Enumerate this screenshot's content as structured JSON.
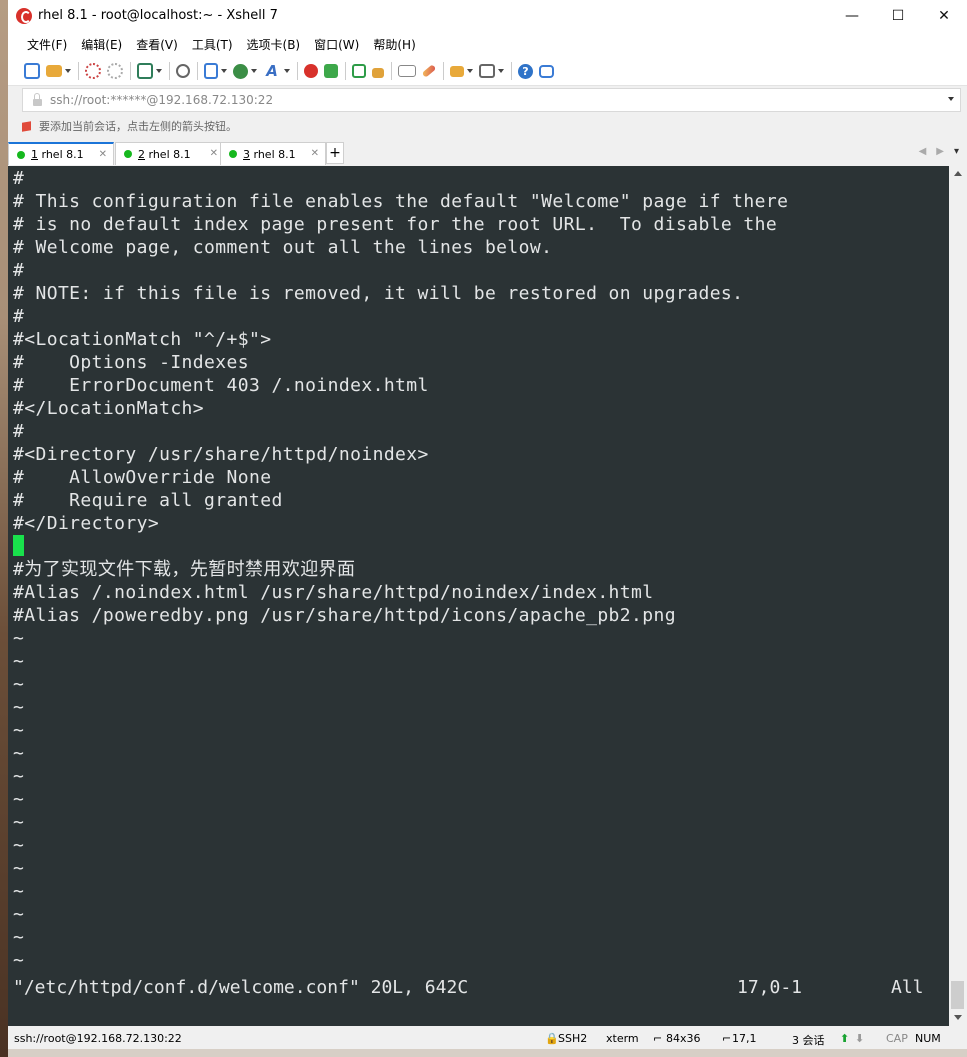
{
  "window": {
    "title": "rhel 8.1 - root@localhost:~ - Xshell 7",
    "minimize": "—",
    "maximize": "☐",
    "close": "✕"
  },
  "menu": [
    "文件(F)",
    "编辑(E)",
    "查看(V)",
    "工具(T)",
    "选项卡(B)",
    "窗口(W)",
    "帮助(H)"
  ],
  "address": {
    "value": "ssh://root:******@192.168.72.130:22"
  },
  "hint": "要添加当前会话，点击左侧的箭头按钮。",
  "tabs": [
    {
      "num": "1",
      "label": " rhel 8.1"
    },
    {
      "num": "2",
      "label": " rhel 8.1"
    },
    {
      "num": "3",
      "label": " rhel 8.1"
    }
  ],
  "tab_plus": "+",
  "terminal": {
    "lines": [
      "#",
      "# This configuration file enables the default \"Welcome\" page if there",
      "# is no default index page present for the root URL.  To disable the",
      "# Welcome page, comment out all the lines below.",
      "#",
      "# NOTE: if this file is removed, it will be restored on upgrades.",
      "#",
      "#<LocationMatch \"^/+$\">",
      "#    Options -Indexes",
      "#    ErrorDocument 403 /.noindex.html",
      "#</LocationMatch>",
      "#",
      "#<Directory /usr/share/httpd/noindex>",
      "#    AllowOverride None",
      "#    Require all granted",
      "#</Directory>",
      "",
      "#为了实现文件下载，先暂时禁用欢迎界面",
      "#Alias /.noindex.html /usr/share/httpd/noindex/index.html",
      "#Alias /poweredby.png /usr/share/httpd/icons/apache_pb2.png",
      "~",
      "~",
      "~",
      "~",
      "~",
      "~",
      "~",
      "~",
      "~",
      "~",
      "~",
      "~",
      "~",
      "~",
      "~"
    ],
    "status_file": "\"/etc/httpd/conf.d/welcome.conf\" 20L, 642C",
    "status_pos": "17,0-1",
    "status_scroll": "All"
  },
  "statusbar": {
    "connection": "ssh://root@192.168.72.130:22",
    "protocol": "SSH2",
    "term": "xterm",
    "size": "84x36",
    "cursor": "17,1",
    "sessions": "3 会话",
    "cap": "CAP",
    "num": "NUM"
  },
  "colors": {
    "terminal_bg": "#2b3335",
    "terminal_fg": "#e3e5e6",
    "cursor": "#19e14c",
    "tab_active_accent": "#1b74d8",
    "session_dot": "#16b81e"
  }
}
